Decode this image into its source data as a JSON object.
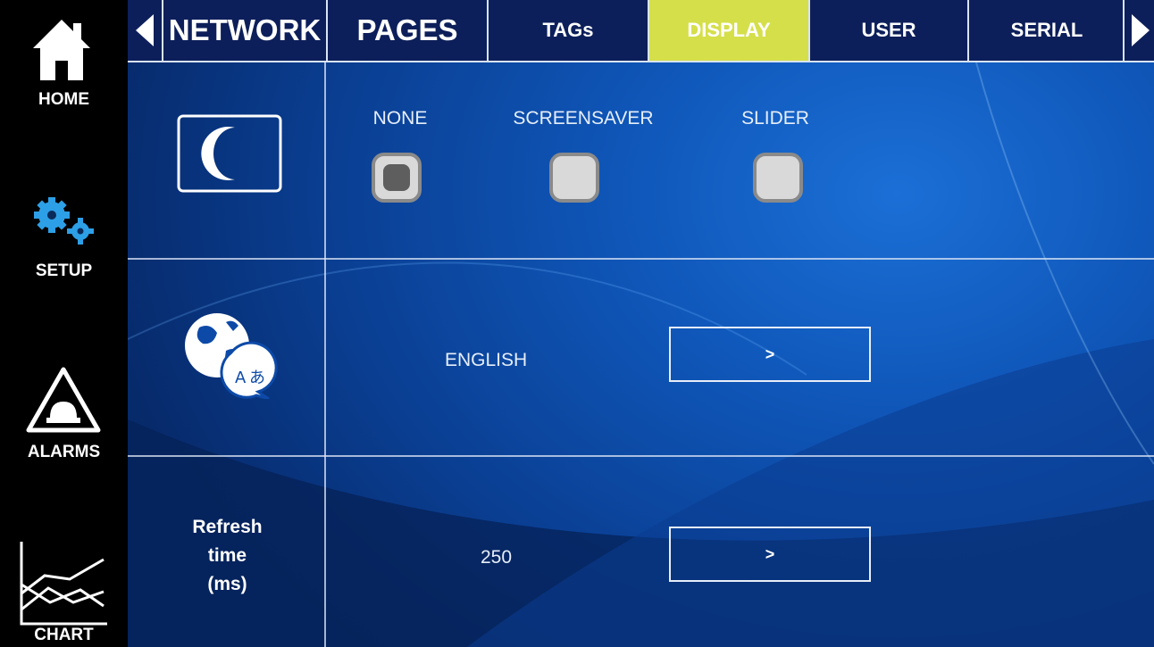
{
  "sidebar": {
    "items": [
      {
        "label": "HOME",
        "icon": "home-icon"
      },
      {
        "label": "SETUP",
        "icon": "gears-icon"
      },
      {
        "label": "ALARMS",
        "icon": "alarm-icon"
      },
      {
        "label": "CHART",
        "icon": "chart-icon"
      }
    ]
  },
  "tabs": {
    "items": [
      {
        "label": "NETWORK"
      },
      {
        "label": "PAGES"
      },
      {
        "label": "TAGs"
      },
      {
        "label": "DISPLAY",
        "active": true
      },
      {
        "label": "USER"
      },
      {
        "label": "SERIAL"
      }
    ],
    "active_color": "#d5df4a"
  },
  "screensaver": {
    "icon": "moon-icon",
    "options": [
      {
        "label": "NONE",
        "selected": true
      },
      {
        "label": "SCREENSAVER",
        "selected": false
      },
      {
        "label": "SLIDER",
        "selected": false
      }
    ]
  },
  "language": {
    "icon": "language-globe-icon",
    "value": "ENGLISH",
    "button_label": ">"
  },
  "refresh": {
    "label_line1": "Refresh",
    "label_line2": "time",
    "label_line3": "(ms)",
    "value": "250",
    "button_label": ">"
  }
}
